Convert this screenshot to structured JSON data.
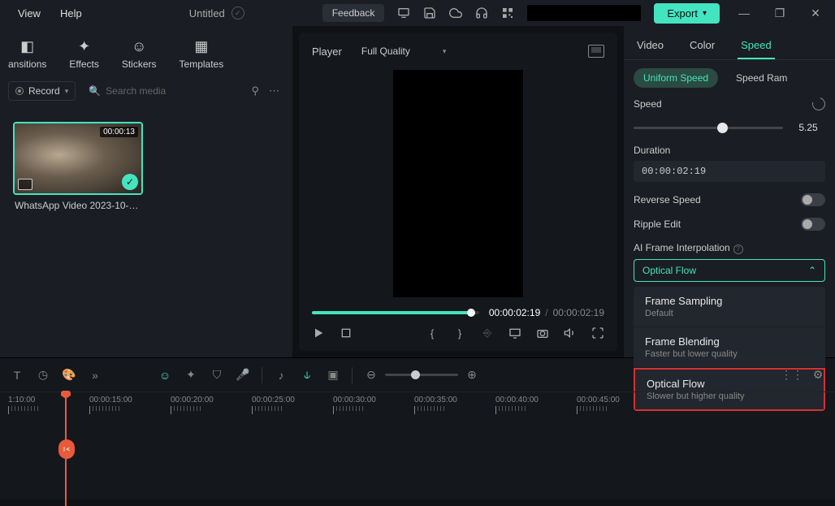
{
  "menu": {
    "view": "View",
    "help": "Help"
  },
  "title": "Untitled",
  "feedback": "Feedback",
  "export": "Export",
  "asset_tabs": [
    {
      "label": "Transitions",
      "truncated": "ansitions"
    },
    {
      "label": "Effects"
    },
    {
      "label": "Stickers"
    },
    {
      "label": "Templates"
    }
  ],
  "record_label": "Record",
  "search_placeholder": "Search media",
  "media": {
    "duration": "00:00:13",
    "name": "WhatsApp Video 2023-10-05..."
  },
  "player": {
    "label": "Player",
    "quality": "Full Quality",
    "current_time": "00:00:02:19",
    "total_time": "00:00:02:19"
  },
  "timeline_marks": [
    "1:10:00",
    "00:00:15:00",
    "00:00:20:00",
    "00:00:25:00",
    "00:00:30:00",
    "00:00:35:00",
    "00:00:40:00",
    "00:00:45:00"
  ],
  "props": {
    "tabs": {
      "video": "Video",
      "color": "Color",
      "speed": "Speed"
    },
    "sub_tabs": {
      "uniform": "Uniform Speed",
      "ramp": "Speed Ramping",
      "ramp_truncated": "Speed Ram"
    },
    "speed_label": "Speed",
    "speed_value": "5.25",
    "duration_label": "Duration",
    "duration_value": "00:00:02:19",
    "reverse_label": "Reverse Speed",
    "ripple_label": "Ripple Edit",
    "interp_label": "AI Frame Interpolation",
    "interp_selected": "Optical Flow",
    "interp_options": [
      {
        "title": "Frame Sampling",
        "sub": "Default"
      },
      {
        "title": "Frame Blending",
        "sub": "Faster but lower quality"
      },
      {
        "title": "Optical Flow",
        "sub": "Slower but higher quality"
      }
    ]
  }
}
